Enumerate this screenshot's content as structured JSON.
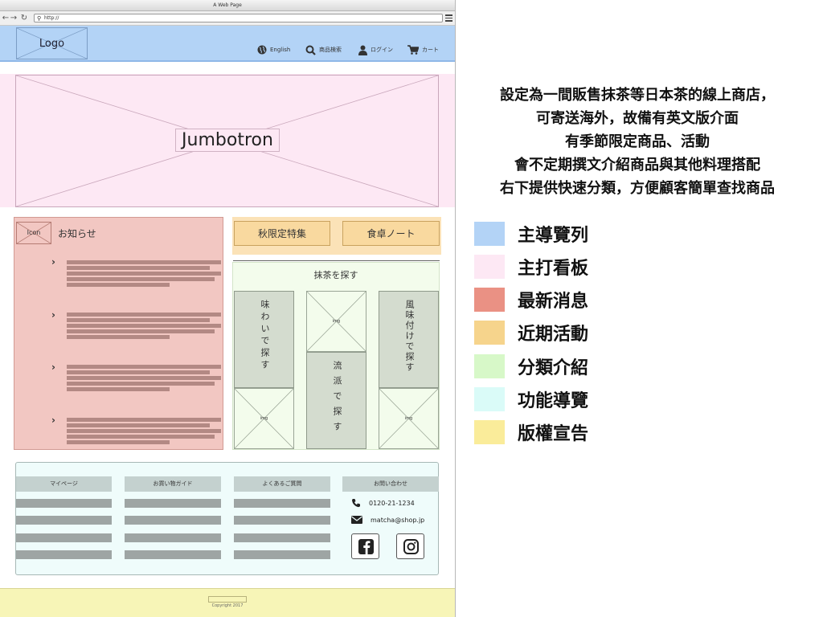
{
  "browser": {
    "title": "A Web Page",
    "url": "http://"
  },
  "nav": {
    "logo": "Logo",
    "items": [
      {
        "label": "English",
        "icon": "globe-icon"
      },
      {
        "label": "商品検索",
        "icon": "search-icon"
      },
      {
        "label": "ログイン",
        "icon": "user-icon"
      },
      {
        "label": "カート",
        "icon": "cart-icon"
      }
    ]
  },
  "jumbotron": {
    "label": "Jumbotron"
  },
  "news": {
    "icon_label": "Icon",
    "title": "お知らせ"
  },
  "campaigns": {
    "buttons": [
      "秋限定特集",
      "食卓ノート"
    ]
  },
  "category": {
    "title": "抹茶を探す",
    "columns": [
      {
        "label": "味わいで探す",
        "img": "img"
      },
      {
        "label": "流派で探す",
        "img": "img"
      },
      {
        "label": "風味付けで探す",
        "img": "img"
      }
    ]
  },
  "footer_nav": {
    "headers": [
      "マイページ",
      "お買い物ガイド",
      "よくあるご質問",
      "お問い合わせ"
    ],
    "phone": "0120-21-1234",
    "email": "matcha@shop.jp",
    "social": [
      "facebook-icon",
      "instagram-icon"
    ]
  },
  "copyright": {
    "text": "Copyright 2017"
  },
  "description": [
    "設定為一間販售抹茶等日本茶的線上商店，",
    "可寄送海外，故備有英文版介面",
    "有季節限定商品、活動",
    "會不定期撰文介紹商品與其他料理搭配",
    "右下提供快速分類，方便顧客簡單查找商品"
  ],
  "legend": [
    {
      "label": "主導覽列",
      "color": "#b3d3f6"
    },
    {
      "label": "主打看板",
      "color": "#fde8f4"
    },
    {
      "label": "最新消息",
      "color": "#ea9184"
    },
    {
      "label": "近期活動",
      "color": "#f6d48c"
    },
    {
      "label": "分類介紹",
      "color": "#d7f8c8"
    },
    {
      "label": "功能導覽",
      "color": "#dafbf8"
    },
    {
      "label": "版權宣告",
      "color": "#faec9a"
    }
  ]
}
